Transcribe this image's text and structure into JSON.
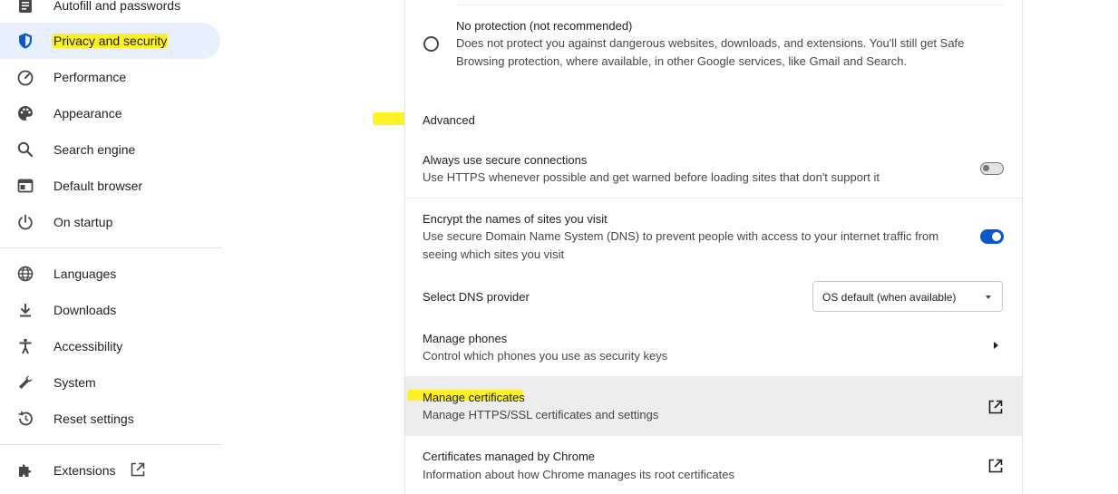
{
  "sidebar": {
    "items": [
      {
        "label": "Autofill and passwords",
        "icon": "clipboard-icon"
      },
      {
        "label": "Privacy and security",
        "icon": "shield-icon",
        "active": true
      },
      {
        "label": "Performance",
        "icon": "speedometer-icon"
      },
      {
        "label": "Appearance",
        "icon": "palette-icon"
      },
      {
        "label": "Search engine",
        "icon": "search-icon"
      },
      {
        "label": "Default browser",
        "icon": "browser-window-icon"
      },
      {
        "label": "On startup",
        "icon": "power-icon"
      },
      {
        "label": "Languages",
        "icon": "globe-icon"
      },
      {
        "label": "Downloads",
        "icon": "download-icon"
      },
      {
        "label": "Accessibility",
        "icon": "accessibility-icon"
      },
      {
        "label": "System",
        "icon": "wrench-icon"
      },
      {
        "label": "Reset settings",
        "icon": "history-icon"
      },
      {
        "label": "Extensions",
        "icon": "puzzle-icon"
      }
    ]
  },
  "main": {
    "no_protection": {
      "title": "No protection (not recommended)",
      "description_line1": "Does not protect you against dangerous websites, downloads, and extensions. You'll still get Safe",
      "description_line2": "Browsing protection, where available, in other Google services, like Gmail and Search."
    },
    "advanced_heading": "Advanced",
    "secure_connections": {
      "title": "Always use secure connections",
      "description": "Use HTTPS whenever possible and get warned before loading sites that don't support it",
      "enabled": false
    },
    "encrypt_dns": {
      "title": "Encrypt the names of sites you visit",
      "description_line1": "Use secure Domain Name System (DNS) to prevent people with access to your internet traffic from",
      "description_line2": "seeing which sites you visit",
      "enabled": true
    },
    "dns_provider": {
      "label": "Select DNS provider",
      "selected": "OS default (when available)"
    },
    "manage_phones": {
      "title": "Manage phones",
      "description": "Control which phones you use as security keys"
    },
    "manage_certificates": {
      "title": "Manage certificates",
      "description": "Manage HTTPS/SSL certificates and settings"
    },
    "chrome_certificates": {
      "title": "Certificates managed by Chrome",
      "description": "Information about how Chrome manages its root certificates"
    }
  },
  "colors": {
    "accent": "#0b57d0",
    "active_nav_bg": "#e8f0fe",
    "highlight": "#fff000",
    "hover_row_bg": "#ededed"
  }
}
